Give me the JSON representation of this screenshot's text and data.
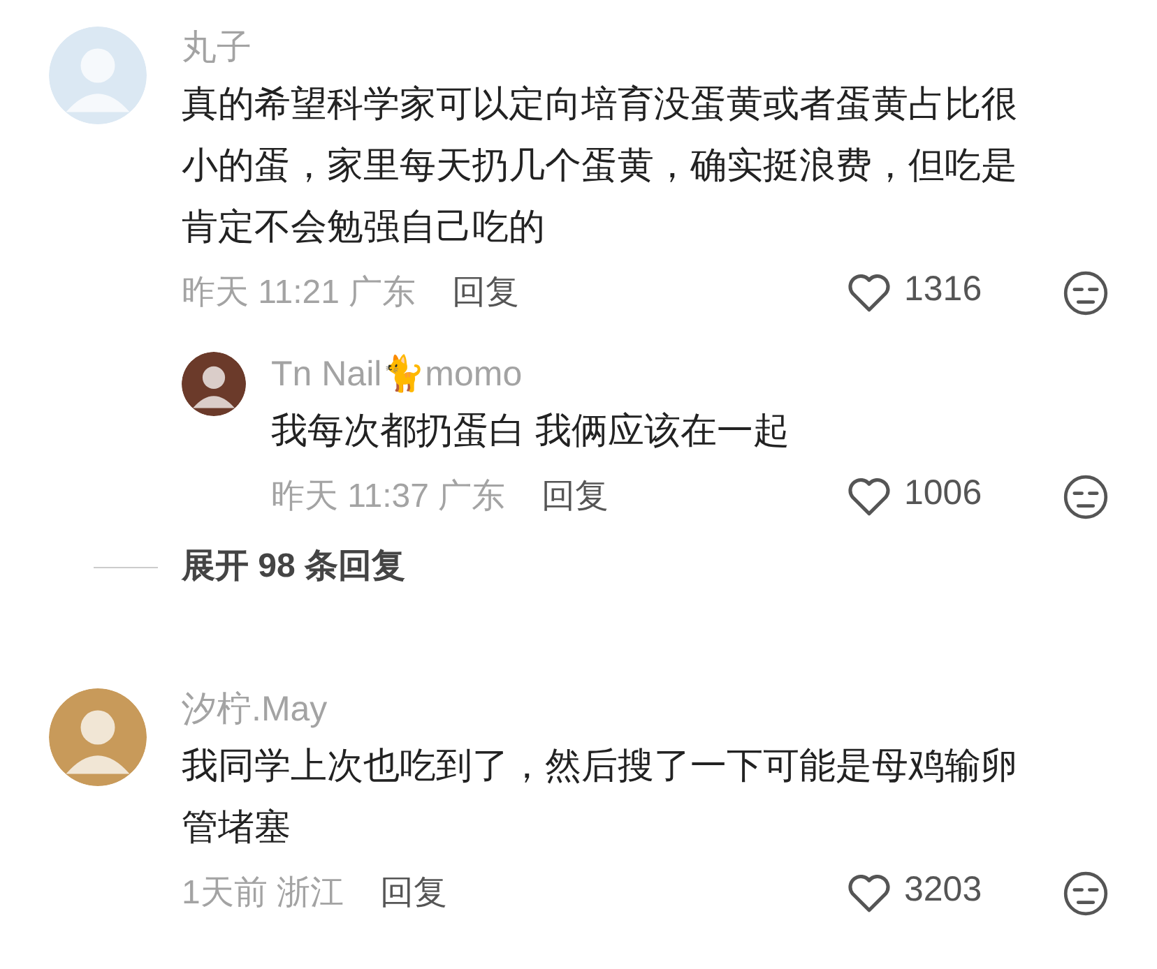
{
  "comments": [
    {
      "user": "丸子",
      "text_lines": [
        "真的希望科学家可以定向培育没蛋黄或者蛋黄占比很",
        "小的蛋，家里每天扔几个蛋黄，确实挺浪费，但吃是",
        "肯定不会勉强自己吃的"
      ],
      "meta": "昨天 11:21 广东",
      "reply_label": "回复",
      "likes": "1316",
      "replies": [
        {
          "user": "Tn Nail🐈momo",
          "text_lines": [
            "我每次都扔蛋白 我俩应该在一起"
          ],
          "meta": "昨天 11:37 广东",
          "reply_label": "回复",
          "likes": "1006"
        }
      ],
      "expand_label": "展开 98 条回复"
    },
    {
      "user": "汐柠.May",
      "text_lines": [
        "我同学上次也吃到了，然后搜了一下可能是母鸡输卵",
        "管堵塞"
      ],
      "meta": "1天前 浙江",
      "reply_label": "回复",
      "likes": "3203"
    }
  ]
}
